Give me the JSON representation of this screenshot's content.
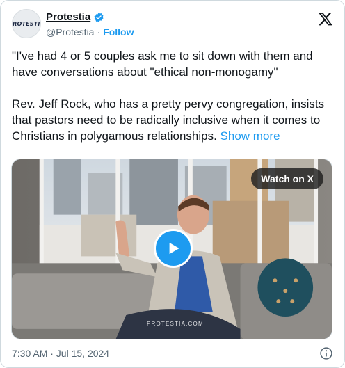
{
  "author": {
    "avatar_text": "PROTESTIA",
    "name": "Protestia",
    "handle": "@Protestia",
    "separator": "·",
    "follow_label": "Follow",
    "verified_icon": "verified-badge-icon"
  },
  "tweet": {
    "line1": "\"I've had 4 or 5 couples ask me to sit down with them and have conversations about \"ethical non-monogamy\"",
    "line2": "Rev. Jeff Rock, who has a pretty pervy congregation, insists that pastors need to be radically inclusive when it comes to Christians in polygamous relationships.",
    "show_more": "Show more"
  },
  "media": {
    "watch_label": "Watch on X",
    "watermark": "PROTESTIA.COM",
    "play_icon": "play-icon"
  },
  "footer": {
    "timestamp": "7:30 AM · Jul 15, 2024",
    "info_icon": "info-icon"
  },
  "colors": {
    "accent": "#1d9bf0",
    "text": "#0f1419",
    "secondary": "#536471"
  }
}
